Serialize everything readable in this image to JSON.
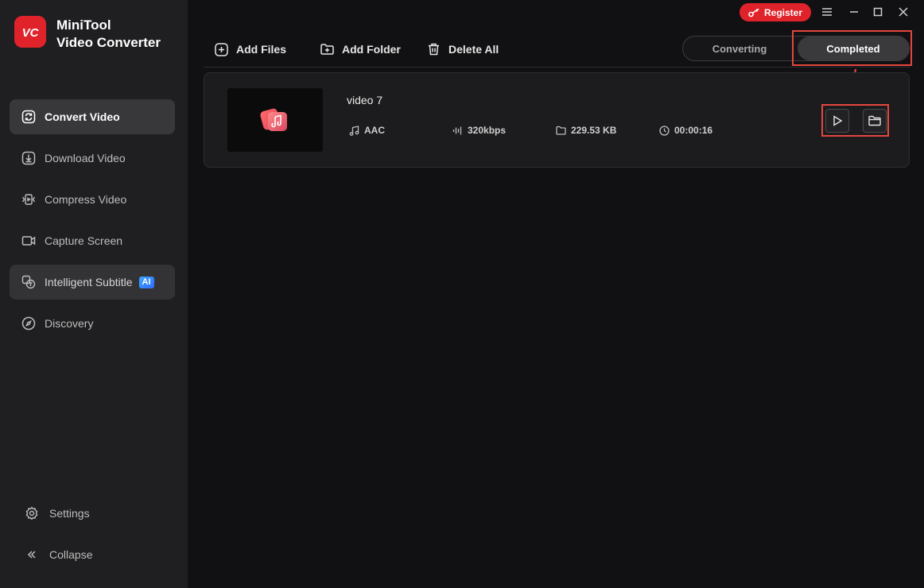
{
  "app": {
    "name_line1": "MiniTool",
    "name_line2": "Video Converter",
    "logo_text": "VC",
    "brand_color": "#e0232a"
  },
  "sidebar": {
    "items": [
      {
        "label": "Convert Video",
        "icon": "convert-icon",
        "active": true
      },
      {
        "label": "Download Video",
        "icon": "download-icon"
      },
      {
        "label": "Compress Video",
        "icon": "compress-icon"
      },
      {
        "label": "Capture Screen",
        "icon": "camera-icon"
      },
      {
        "label": "Intelligent Subtitle",
        "icon": "subtitle-icon",
        "badge": "AI"
      },
      {
        "label": "Discovery",
        "icon": "compass-icon"
      }
    ],
    "settings_label": "Settings",
    "collapse_label": "Collapse"
  },
  "titlebar": {
    "register_label": "Register"
  },
  "toolbar": {
    "add_files": "Add Files",
    "add_folder": "Add Folder",
    "delete_all": "Delete All"
  },
  "tabs": {
    "converting": "Converting",
    "completed": "Completed",
    "selected": "Completed"
  },
  "files": [
    {
      "name": "video 7",
      "format": "AAC",
      "bitrate": "320kbps",
      "size": "229.53 KB",
      "duration": "00:00:16"
    }
  ],
  "annotation": {
    "color": "#e5463f"
  }
}
